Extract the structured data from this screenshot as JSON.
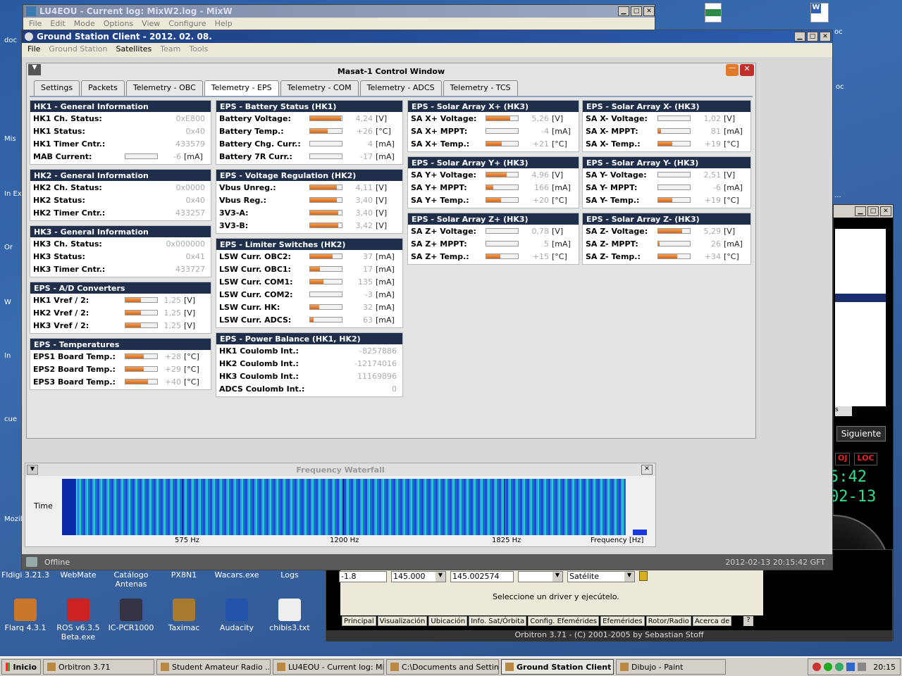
{
  "desktop": {
    "icons": [
      {
        "label": "Flarq 4.3.1"
      },
      {
        "label": "ROS v6.3.5 Beta.exe"
      },
      {
        "label": "IC-PCR1000"
      },
      {
        "label": "Taximac"
      },
      {
        "label": "Audacity"
      },
      {
        "label": "chibis3.txt"
      }
    ],
    "row_labels": [
      "Fldigi 3.21.3",
      "WebMate",
      "Catálogo Antenas",
      "PX8N1",
      "Wacars.exe",
      "Logs"
    ],
    "left_fragments": [
      "doc",
      "Mis",
      "In Ex",
      "Or",
      "W",
      "In",
      "cue",
      "Mozil"
    ]
  },
  "mixw": {
    "title": "LU4EOU - Current log: MixW2.log - MixW",
    "menu": [
      "File",
      "Edit",
      "Mode",
      "Options",
      "View",
      "Configure",
      "Help"
    ]
  },
  "gsc": {
    "title": "Ground Station Client - 2012. 02. 08.",
    "menu": [
      "File",
      "Ground Station",
      "Satellites",
      "Team",
      "Tools"
    ],
    "status": "Offline",
    "timestamp": "2012-02-13 20:15:42 GFT"
  },
  "control": {
    "title": "Masat-1 Control Window",
    "tabs": [
      "Settings",
      "Packets",
      "Telemetry - OBC",
      "Telemetry - EPS",
      "Telemetry - COM",
      "Telemetry - ADCS",
      "Telemetry - TCS"
    ]
  },
  "panels": {
    "hk1": {
      "title": "HK1 - General Information",
      "rows": [
        {
          "label": "HK1 Ch. Status:",
          "value": "0xE800"
        },
        {
          "label": "HK1 Status:",
          "value": "0x40"
        },
        {
          "label": "HK1 Timer Cntr.:",
          "value": "433579"
        },
        {
          "label": "MAB Current:",
          "value": "-6",
          "unit": "[mA]",
          "level": 0
        }
      ]
    },
    "hk2": {
      "title": "HK2 - General Information",
      "rows": [
        {
          "label": "HK2 Ch. Status:",
          "value": "0x0000"
        },
        {
          "label": "HK2 Status:",
          "value": "0x40"
        },
        {
          "label": "HK2 Timer Cntr.:",
          "value": "433257"
        }
      ]
    },
    "hk3": {
      "title": "HK3 - General Information",
      "rows": [
        {
          "label": "HK3 Ch. Status:",
          "value": "0x000000"
        },
        {
          "label": "HK3 Status:",
          "value": "0x41"
        },
        {
          "label": "HK3 Timer Cntr.:",
          "value": "433727"
        }
      ]
    },
    "adc": {
      "title": "EPS - A/D Converters",
      "rows": [
        {
          "label": "HK1 Vref / 2:",
          "value": "1,25",
          "unit": "[V]",
          "level": 0.48
        },
        {
          "label": "HK2 Vref / 2:",
          "value": "1,25",
          "unit": "[V]",
          "level": 0.48
        },
        {
          "label": "HK3 Vref / 2:",
          "value": "1,25",
          "unit": "[V]",
          "level": 0.48
        }
      ]
    },
    "temps": {
      "title": "EPS - Temperatures",
      "rows": [
        {
          "label": "EPS1 Board Temp.:",
          "value": "+28",
          "unit": "[°C]",
          "level": 0.58
        },
        {
          "label": "EPS2 Board Temp.:",
          "value": "+29",
          "unit": "[°C]",
          "level": 0.58
        },
        {
          "label": "EPS3 Board Temp.:",
          "value": "+40",
          "unit": "[°C]",
          "level": 0.7
        }
      ]
    },
    "battery": {
      "title": "EPS - Battery Status (HK1)",
      "rows": [
        {
          "label": "Battery Voltage:",
          "value": "4,24",
          "unit": "[V]",
          "level": 0.98
        },
        {
          "label": "Battery Temp.:",
          "value": "+26",
          "unit": "[°C]",
          "level": 0.55
        },
        {
          "label": "Battery Chg. Curr.:",
          "value": "4",
          "unit": "[mA]",
          "level": 0
        },
        {
          "label": "Battery 7R Curr.:",
          "value": "-17",
          "unit": "[mA]",
          "level": 0
        }
      ]
    },
    "vreg": {
      "title": "EPS - Voltage Regulation (HK2)",
      "rows": [
        {
          "label": "Vbus Unreg.:",
          "value": "4,11",
          "unit": "[V]",
          "level": 0.85
        },
        {
          "label": "Vbus Reg.:",
          "value": "3,40",
          "unit": "[V]",
          "level": 0.85
        },
        {
          "label": "3V3-A:",
          "value": "3,40",
          "unit": "[V]",
          "level": 0.88
        },
        {
          "label": "3V3-B:",
          "value": "3,42",
          "unit": "[V]",
          "level": 0.88
        }
      ]
    },
    "lsw": {
      "title": "EPS - Limiter Switches (HK2)",
      "rows": [
        {
          "label": "LSW Curr. OBC2:",
          "value": "37",
          "unit": "[mA]",
          "level": 0.72
        },
        {
          "label": "LSW Curr. OBC1:",
          "value": "17",
          "unit": "[mA]",
          "level": 0.3
        },
        {
          "label": "LSW Curr. COM1:",
          "value": "135",
          "unit": "[mA]",
          "level": 0.42
        },
        {
          "label": "LSW Curr. COM2:",
          "value": "-3",
          "unit": "[mA]",
          "level": 0
        },
        {
          "label": "LSW Curr. HK:",
          "value": "32",
          "unit": "[mA]",
          "level": 0.28
        },
        {
          "label": "LSW Curr. ADCS:",
          "value": "63",
          "unit": "[mA]",
          "level": 0.1
        }
      ]
    },
    "power": {
      "title": "EPS - Power Balance (HK1, HK2)",
      "rows": [
        {
          "label": "HK1 Coulomb Int.:",
          "value": "-8257886"
        },
        {
          "label": "HK2 Coulomb Int.:",
          "value": "-12174016"
        },
        {
          "label": "HK3 Coulomb Int.:",
          "value": "11169896"
        },
        {
          "label": "ADCS Coulomb Int.:",
          "value": "0"
        }
      ]
    },
    "sxp": {
      "title": "EPS - Solar Array X+ (HK3)",
      "rows": [
        {
          "label": "SA X+ Voltage:",
          "value": "5,26",
          "unit": "[V]",
          "level": 0.75
        },
        {
          "label": "SA X+ MPPT:",
          "value": "-4",
          "unit": "[mA]",
          "level": 0
        },
        {
          "label": "SA X+ Temp.:",
          "value": "+21",
          "unit": "[°C]",
          "level": 0.48
        }
      ]
    },
    "sxm": {
      "title": "EPS - Solar Array X- (HK3)",
      "rows": [
        {
          "label": "SA X- Voltage:",
          "value": "1,02",
          "unit": "[V]",
          "level": 0
        },
        {
          "label": "SA X- MPPT:",
          "value": "81",
          "unit": "[mA]",
          "level": 0.08
        },
        {
          "label": "SA X- Temp.:",
          "value": "+19",
          "unit": "[°C]",
          "level": 0.45
        }
      ]
    },
    "syp": {
      "title": "EPS - Solar Array Y+ (HK3)",
      "rows": [
        {
          "label": "SA Y+ Voltage:",
          "value": "4,96",
          "unit": "[V]",
          "level": 0.65
        },
        {
          "label": "SA Y+ MPPT:",
          "value": "166",
          "unit": "[mA]",
          "level": 0.22
        },
        {
          "label": "SA Y+ Temp.:",
          "value": "+20",
          "unit": "[°C]",
          "level": 0.46
        }
      ]
    },
    "sym": {
      "title": "EPS - Solar Array Y- (HK3)",
      "rows": [
        {
          "label": "SA Y- Voltage:",
          "value": "2,51",
          "unit": "[V]",
          "level": 0
        },
        {
          "label": "SA Y- MPPT:",
          "value": "-6",
          "unit": "[mA]",
          "level": 0
        },
        {
          "label": "SA Y- Temp.:",
          "value": "+19",
          "unit": "[°C]",
          "level": 0.45
        }
      ]
    },
    "szp": {
      "title": "EPS - Solar Array Z+ (HK3)",
      "rows": [
        {
          "label": "SA Z+ Voltage:",
          "value": "0,78",
          "unit": "[V]",
          "level": 0
        },
        {
          "label": "SA Z+ MPPT:",
          "value": "5",
          "unit": "[mA]",
          "level": 0
        },
        {
          "label": "SA Z+ Temp.:",
          "value": "+15",
          "unit": "[°C]",
          "level": 0.45
        }
      ]
    },
    "szm": {
      "title": "EPS - Solar Array Z- (HK3)",
      "rows": [
        {
          "label": "SA Z- Voltage:",
          "value": "5,29",
          "unit": "[V]",
          "level": 0.75
        },
        {
          "label": "SA Z- MPPT:",
          "value": "26",
          "unit": "[mA]",
          "level": 0.04
        },
        {
          "label": "SA Z- Temp.:",
          "value": "+34",
          "unit": "[°C]",
          "level": 0.6
        }
      ]
    }
  },
  "waterfall": {
    "title": "Frequency Waterfall",
    "time_label": "Time",
    "ticks": [
      "575 Hz",
      "1200 Hz",
      "1825 Hz"
    ],
    "freq_label": "Frequency [Hz]"
  },
  "orbitron": {
    "field1": "-1.8",
    "field2": "145.000",
    "field3": "145.002574",
    "field5": "Satélite",
    "message": "Seleccione un driver y ejecútelo.",
    "tabs": [
      "Principal",
      "Visualización",
      "Ubicación",
      "Info. Sat/Órbita",
      "Config. Efemérides",
      "Efemérides",
      "Rotor/Radio",
      "Acerca de"
    ],
    "footer": "Orbitron 3.71 - (C) 2001-2005 by Sebastian Stoff",
    "button": "Siguiente",
    "label_oj": "OJ",
    "label_loc": "LOC",
    "time1": "5:42",
    "time2": "02-13",
    "tab_s": "s"
  },
  "taskbar": {
    "start": "Inicio",
    "items": [
      "Orbitron 3.71",
      "Student Amateur Radio ...",
      "LU4EOU - Current log: Mi...",
      "C:\\Documents and Settin...",
      "Ground Station Client ...",
      "Dibujo - Paint"
    ],
    "clock": "20:15"
  }
}
